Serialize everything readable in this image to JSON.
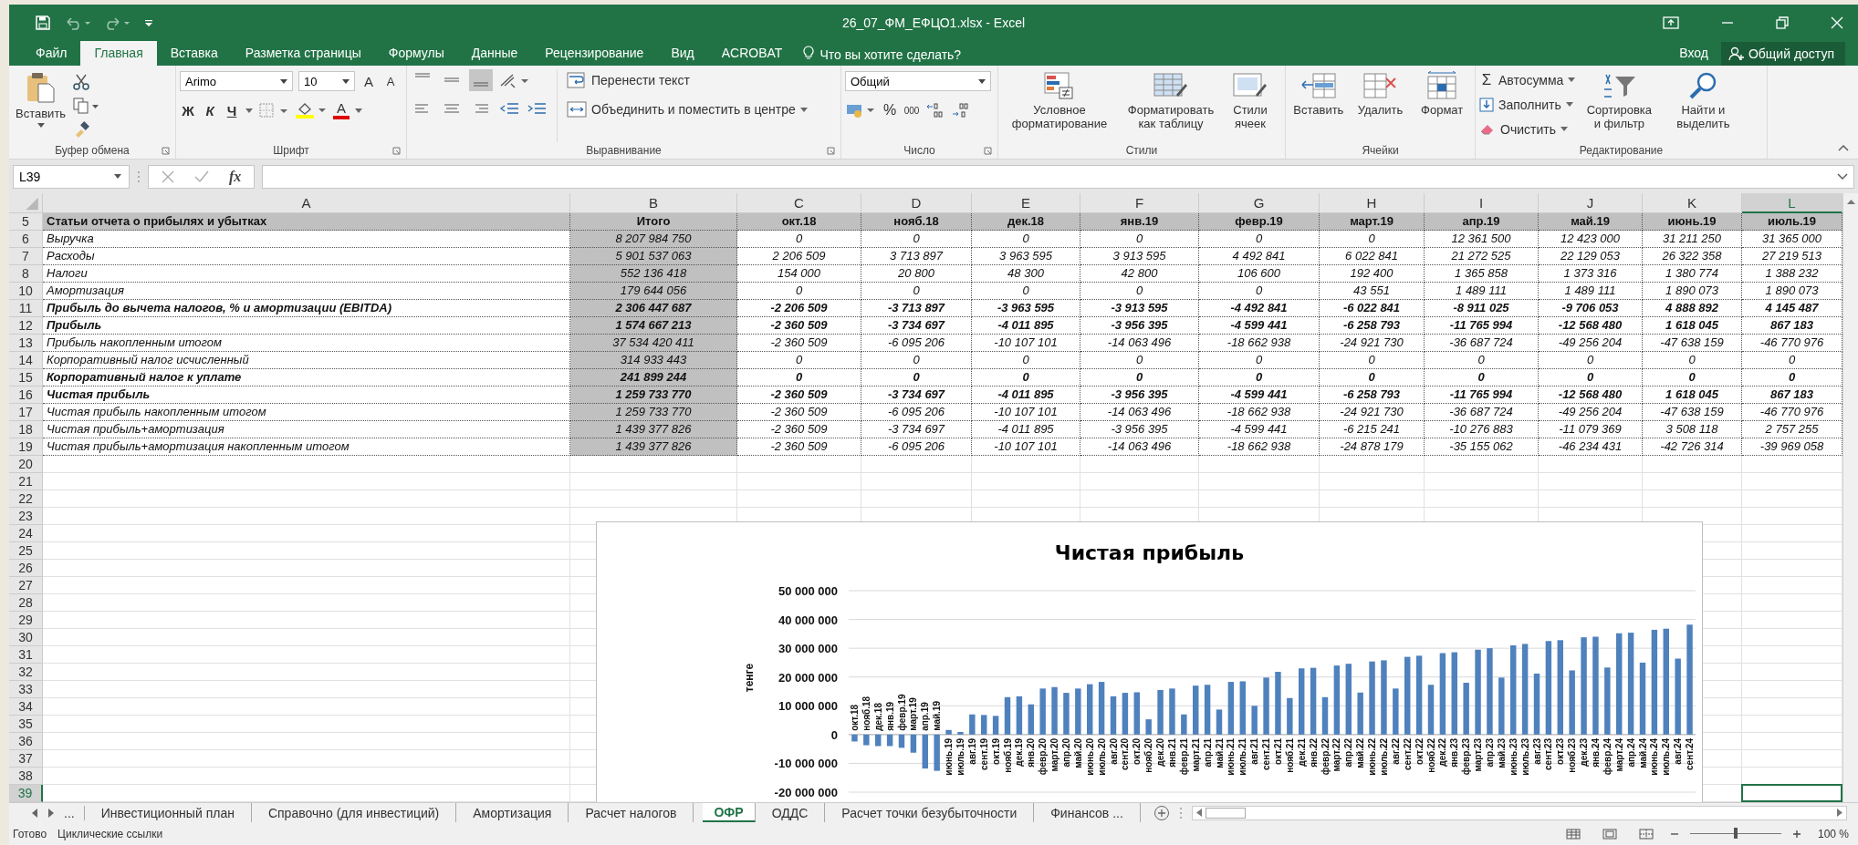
{
  "window": {
    "title": "26_07_ФМ_ЕФЦО1.xlsx - Excel"
  },
  "tabs": [
    {
      "label": "Файл",
      "selected": false
    },
    {
      "label": "Главная",
      "selected": true
    },
    {
      "label": "Вставка",
      "selected": false
    },
    {
      "label": "Разметка страницы",
      "selected": false
    },
    {
      "label": "Формулы",
      "selected": false
    },
    {
      "label": "Данные",
      "selected": false
    },
    {
      "label": "Рецензирование",
      "selected": false
    },
    {
      "label": "Вид",
      "selected": false
    },
    {
      "label": "ACROBAT",
      "selected": false
    }
  ],
  "tell_me": {
    "placeholder": "Что вы хотите сделать?"
  },
  "sign_in": "Вход",
  "share": "Общий доступ",
  "ribbon": {
    "clipboard": {
      "label": "Буфер обмена",
      "paste": "Вставить"
    },
    "font": {
      "label": "Шрифт",
      "font_name": "Arimo",
      "font_size": "10",
      "grow": "A",
      "shrink": "A",
      "bold": "Ж",
      "italic": "К",
      "underline": "Ч",
      "font_color_button": "A"
    },
    "alignment": {
      "label": "Выравнивание",
      "vertical": [
        {
          "selected": false
        },
        {
          "selected": false
        },
        {
          "selected": true
        }
      ],
      "wrap": "Перенести текст",
      "merge": "Объединить и поместить в центре"
    },
    "number": {
      "label": "Число",
      "format": "Общий",
      "percent": "%",
      "thousands": "000"
    },
    "styles": {
      "label": "Стили",
      "conditional": "Условное форматирование",
      "as_table": "Форматировать как таблицу",
      "cell_styles": "Стили ячеек"
    },
    "cells": {
      "label": "Ячейки",
      "insert": "Вставить",
      "delete": "Удалить",
      "format": "Формат"
    },
    "editing": {
      "label": "Редактирование",
      "sigma": "Σ",
      "autosum": "Автосумма",
      "fill": "Заполнить",
      "clear": "Очистить",
      "sort": "Сортировка и фильтр",
      "find": "Найти и выделить"
    }
  },
  "formula_bar": {
    "name_box": "L39",
    "fx": "fx"
  },
  "table": {
    "columns": [
      {
        "label": "A",
        "selected": false
      },
      {
        "label": "B",
        "selected": false
      },
      {
        "label": "C",
        "selected": false
      },
      {
        "label": "D",
        "selected": false
      },
      {
        "label": "E",
        "selected": false
      },
      {
        "label": "F",
        "selected": false
      },
      {
        "label": "G",
        "selected": false
      },
      {
        "label": "H",
        "selected": false
      },
      {
        "label": "I",
        "selected": false
      },
      {
        "label": "J",
        "selected": false
      },
      {
        "label": "K",
        "selected": false
      },
      {
        "label": "L",
        "selected": true
      }
    ],
    "rows": [
      {
        "num": "5",
        "kind": "header",
        "cells": [
          "Статьи отчета о прибылях и убытках",
          "Итого",
          "окт.18",
          "нояб.18",
          "дек.18",
          "янв.19",
          "февр.19",
          "март.19",
          "апр.19",
          "май.19",
          "июнь.19",
          "июль.19"
        ]
      },
      {
        "num": "6",
        "kind": "italic",
        "cells": [
          "Выручка",
          "8 207 984 750",
          "0",
          "0",
          "0",
          "0",
          "0",
          "0",
          "12 361 500",
          "12 423 000",
          "31 211 250",
          "31 365 000"
        ]
      },
      {
        "num": "7",
        "kind": "italic",
        "cells": [
          "Расходы",
          "5 901 537 063",
          "2 206 509",
          "3 713 897",
          "3 963 595",
          "3 913 595",
          "4 492 841",
          "6 022 841",
          "21 272 525",
          "22 129 053",
          "26 322 358",
          "27 219 513"
        ]
      },
      {
        "num": "8",
        "kind": "italic",
        "cells": [
          "Налоги",
          "552 136 418",
          "154 000",
          "20 800",
          "48 300",
          "42 800",
          "106 600",
          "192 400",
          "1 365 858",
          "1 373 316",
          "1 380 774",
          "1 388 232"
        ]
      },
      {
        "num": "10",
        "kind": "italic",
        "cells": [
          "Амортизация",
          "179 644 056",
          "0",
          "0",
          "0",
          "0",
          "0",
          "43 551",
          "1 489 111",
          "1 489 111",
          "1 890 073",
          "1 890 073"
        ]
      },
      {
        "num": "11",
        "kind": "bold",
        "cells": [
          "Прибыль до вычета налогов, % и амортизации (EBITDA)",
          "2 306 447 687",
          "-2 206 509",
          "-3 713 897",
          "-3 963 595",
          "-3 913 595",
          "-4 492 841",
          "-6 022 841",
          "-8 911 025",
          "-9 706 053",
          "4 888 892",
          "4 145 487"
        ]
      },
      {
        "num": "12",
        "kind": "bold",
        "cells": [
          "Прибыль",
          "1 574 667 213",
          "-2 360 509",
          "-3 734 697",
          "-4 011 895",
          "-3 956 395",
          "-4 599 441",
          "-6 258 793",
          "-11 765 994",
          "-12 568 480",
          "1 618 045",
          "867 183"
        ]
      },
      {
        "num": "13",
        "kind": "italic",
        "cells": [
          "Прибыль накопленным итогом",
          "37 534 420 411",
          "-2 360 509",
          "-6 095 206",
          "-10 107 101",
          "-14 063 496",
          "-18 662 938",
          "-24 921 730",
          "-36 687 724",
          "-49 256 204",
          "-47 638 159",
          "-46 770 976"
        ]
      },
      {
        "num": "14",
        "kind": "italic",
        "cells": [
          "Корпоративный налог исчисленный",
          "314 933 443",
          "0",
          "0",
          "0",
          "0",
          "0",
          "0",
          "0",
          "0",
          "0",
          "0"
        ]
      },
      {
        "num": "15",
        "kind": "bold",
        "cells": [
          "Корпоративный налог к уплате",
          "241 899 244",
          "0",
          "0",
          "0",
          "0",
          "0",
          "0",
          "0",
          "0",
          "0",
          "0"
        ]
      },
      {
        "num": "16",
        "kind": "bold",
        "cells": [
          "Чистая прибыль",
          "1 259 733 770",
          "-2 360 509",
          "-3 734 697",
          "-4 011 895",
          "-3 956 395",
          "-4 599 441",
          "-6 258 793",
          "-11 765 994",
          "-12 568 480",
          "1 618 045",
          "867 183"
        ]
      },
      {
        "num": "17",
        "kind": "italic",
        "cells": [
          "Чистая прибыль накопленным итогом",
          "1 259 733 770",
          "-2 360 509",
          "-6 095 206",
          "-10 107 101",
          "-14 063 496",
          "-18 662 938",
          "-24 921 730",
          "-36 687 724",
          "-49 256 204",
          "-47 638 159",
          "-46 770 976"
        ]
      },
      {
        "num": "18",
        "kind": "italic",
        "cells": [
          "Чистая прибыль+амортизация",
          "1 439 377 826",
          "-2 360 509",
          "-3 734 697",
          "-4 011 895",
          "-3 956 395",
          "-4 599 441",
          "-6 215 241",
          "-10 276 883",
          "-11 079 369",
          "3 508 118",
          "2 757 255"
        ]
      },
      {
        "num": "19",
        "kind": "italic",
        "cells": [
          "Чистая прибыль+амортизация накопленным итогом",
          "1 439 377 826",
          "-2 360 509",
          "-6 095 206",
          "-10 107 101",
          "-14 063 496",
          "-18 662 938",
          "-24 878 179",
          "-35 155 062",
          "-46 234 431",
          "-42 726 314",
          "-39 969 058"
        ]
      }
    ],
    "empty_rows": [
      {
        "num": "20",
        "selected": false
      },
      {
        "num": "21",
        "selected": false
      },
      {
        "num": "22",
        "selected": false
      },
      {
        "num": "23",
        "selected": false
      },
      {
        "num": "24",
        "selected": false
      },
      {
        "num": "25",
        "selected": false
      },
      {
        "num": "26",
        "selected": false
      },
      {
        "num": "27",
        "selected": false
      },
      {
        "num": "28",
        "selected": false
      },
      {
        "num": "29",
        "selected": false
      },
      {
        "num": "30",
        "selected": false
      },
      {
        "num": "31",
        "selected": false
      },
      {
        "num": "32",
        "selected": false
      },
      {
        "num": "33",
        "selected": false
      },
      {
        "num": "34",
        "selected": false
      },
      {
        "num": "35",
        "selected": false
      },
      {
        "num": "36",
        "selected": false
      },
      {
        "num": "37",
        "selected": false
      },
      {
        "num": "38",
        "selected": false
      },
      {
        "num": "39",
        "selected": true
      }
    ]
  },
  "chart": {
    "chart_data": {
      "type": "bar",
      "title": "Чистая прибыль",
      "ylabel": "тенге",
      "grid": true,
      "ylim": [
        -20000000,
        50000000
      ],
      "yticks": [
        {
          "value": 50000000,
          "label": "50 000 000"
        },
        {
          "value": 40000000,
          "label": "40 000 000"
        },
        {
          "value": 30000000,
          "label": "30 000 000"
        },
        {
          "value": 20000000,
          "label": "20 000 000"
        },
        {
          "value": 10000000,
          "label": "10 000 000"
        },
        {
          "value": 0,
          "label": "0"
        },
        {
          "value": -10000000,
          "label": "-10 000 000"
        },
        {
          "value": -20000000,
          "label": "-20 000 000"
        }
      ],
      "categories": [
        "окт.18",
        "нояб.18",
        "дек.18",
        "янв.19",
        "февр.19",
        "март.19",
        "апр.19",
        "май.19",
        "июнь.19",
        "июль.19",
        "авг.19",
        "сент.19",
        "окт.19",
        "нояб.19",
        "дек.19",
        "янв.20",
        "февр.20",
        "март.20",
        "апр.20",
        "май.20",
        "июнь.20",
        "июль.20",
        "авг.20",
        "сент.20",
        "окт.20",
        "нояб.20",
        "дек.20",
        "янв.21",
        "февр.21",
        "март.21",
        "апр.21",
        "май.21",
        "июнь.21",
        "июль.21",
        "авг.21",
        "сент.21",
        "окт.21",
        "нояб.21",
        "дек.21",
        "янв.22",
        "февр.22",
        "март.22",
        "апр.22",
        "май.22",
        "июнь.22",
        "июль.22",
        "авг.22",
        "сент.22",
        "окт.22",
        "нояб.22",
        "дек.22",
        "янв.23",
        "февр.23",
        "март.23",
        "апр.23",
        "май.23",
        "июнь.23",
        "июль.23",
        "авг.23",
        "сент.23",
        "окт.23",
        "нояб.23",
        "дек.23",
        "янв.24",
        "февр.24",
        "март.24",
        "апр.24",
        "май.24",
        "июнь.24",
        "июль.24",
        "авг.24",
        "сент.24"
      ],
      "color": "#4f81bd",
      "values": [
        -2400000,
        -3700000,
        -4000000,
        -4000000,
        -4600000,
        -6300000,
        -11800000,
        -12600000,
        1600000,
        900000,
        7000000,
        6800000,
        6500000,
        13000000,
        13300000,
        10500000,
        16000000,
        16500000,
        14500000,
        16000000,
        17500000,
        18300000,
        13300000,
        14500000,
        14700000,
        5300000,
        15500000,
        16000000,
        7000000,
        17000000,
        17300000,
        8700000,
        18300000,
        18500000,
        10000000,
        19800000,
        21800000,
        12700000,
        23000000,
        23200000,
        13000000,
        24000000,
        24600000,
        14600000,
        25400000,
        25800000,
        16000000,
        27000000,
        27400000,
        17300000,
        28300000,
        28600000,
        18000000,
        29500000,
        30000000,
        19800000,
        31000000,
        31500000,
        21200000,
        32500000,
        32800000,
        22300000,
        33800000,
        34000000,
        23300000,
        35200000,
        35400000,
        25000000,
        36400000,
        36800000,
        26400000,
        38200000
      ]
    }
  },
  "sheet_tabs": {
    "more": "...",
    "tabs": [
      {
        "label": "Инвестиционный план",
        "selected": false
      },
      {
        "label": "Справочно (для инвестиций)",
        "selected": false
      },
      {
        "label": "Амортизация",
        "selected": false
      },
      {
        "label": "Расчет налогов",
        "selected": false
      },
      {
        "label": "ОФР",
        "selected": true
      },
      {
        "label": "ОДДС",
        "selected": false
      },
      {
        "label": "Расчет точки безубыточности",
        "selected": false
      },
      {
        "label": "Финансов ...",
        "selected": false
      }
    ]
  },
  "status_bar": {
    "state": "Готово",
    "message": "Циклические ссылки",
    "zoom": {
      "level": 0.5
    },
    "zoom_label": "100 %"
  }
}
